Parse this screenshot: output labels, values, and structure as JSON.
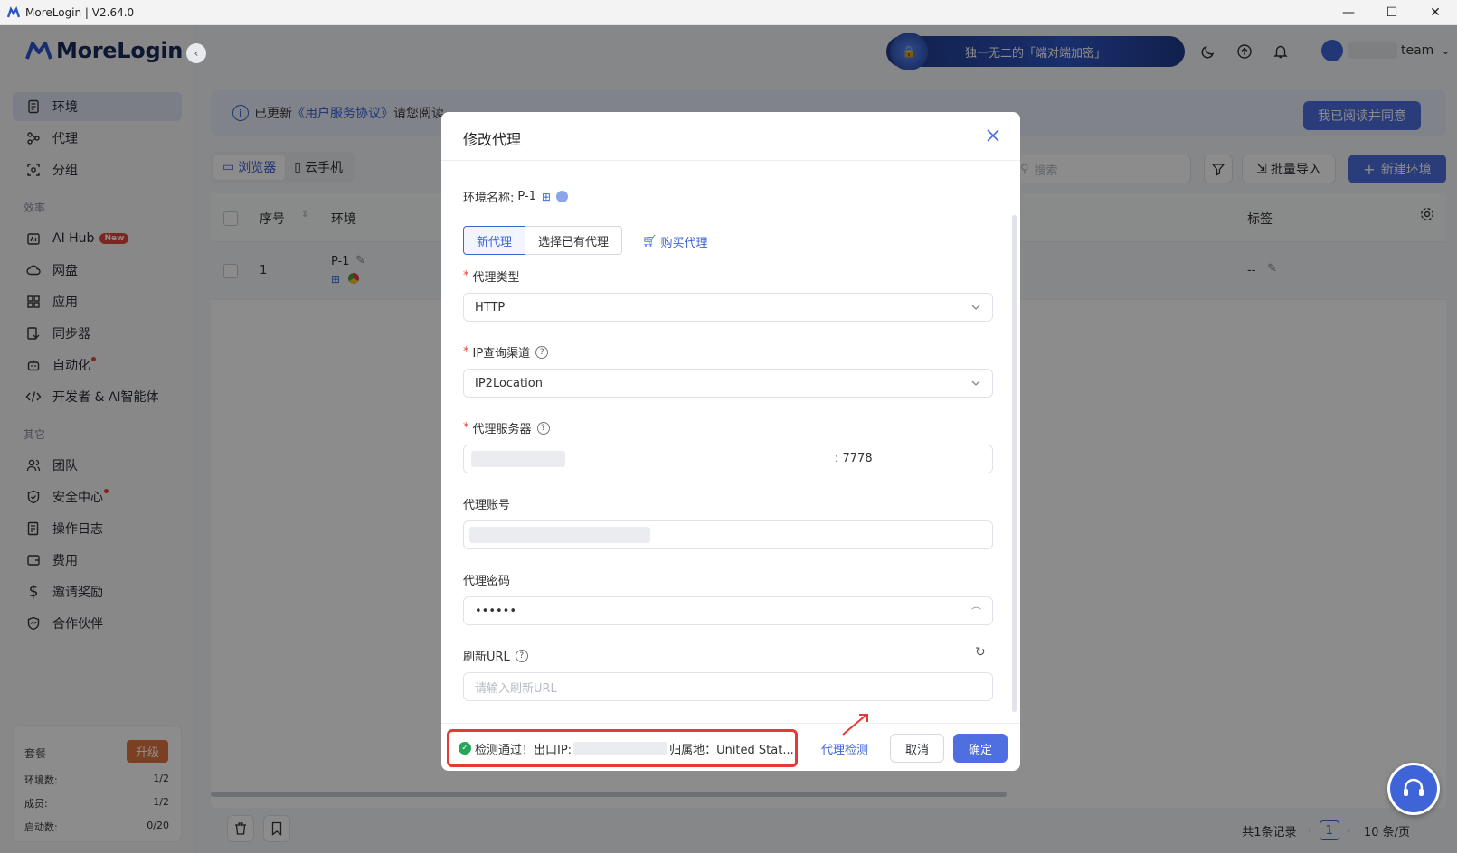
{
  "window": {
    "title": "MoreLogin | V2.64.0"
  },
  "sidebar": {
    "logo": "MoreLogin",
    "items_top": [
      {
        "label": "环境",
        "icon": "doc-icon"
      },
      {
        "label": "代理",
        "icon": "proxy-icon"
      },
      {
        "label": "分组",
        "icon": "group-icon"
      }
    ],
    "section_efficiency": "效率",
    "items_eff": [
      {
        "label": "AI Hub",
        "icon": "ai-icon",
        "badge": "New"
      },
      {
        "label": "网盘",
        "icon": "cloud-icon"
      },
      {
        "label": "应用",
        "icon": "apps-icon"
      },
      {
        "label": "同步器",
        "icon": "sync-icon"
      },
      {
        "label": "自动化",
        "icon": "robot-icon"
      },
      {
        "label": "开发者 & AI智能体",
        "icon": "code-icon"
      }
    ],
    "section_other": "其它",
    "items_other": [
      {
        "label": "团队",
        "icon": "team-icon"
      },
      {
        "label": "安全中心",
        "icon": "shield-icon"
      },
      {
        "label": "操作日志",
        "icon": "log-icon"
      },
      {
        "label": "费用",
        "icon": "wallet-icon"
      },
      {
        "label": "邀请奖励",
        "icon": "dollar-icon"
      },
      {
        "label": "合作伙伴",
        "icon": "partner-icon"
      }
    ],
    "plan": {
      "title": "套餐",
      "upgrade": "升级",
      "rows": [
        {
          "label": "环境数:",
          "value": "1/2"
        },
        {
          "label": "成员:",
          "value": "1/2"
        },
        {
          "label": "启动数:",
          "value": "0/20"
        }
      ]
    }
  },
  "header": {
    "banner": "独一无二的「端对端加密」",
    "user_name": "team"
  },
  "notice": {
    "prefix": "已更新",
    "link": "《用户服务协议》",
    "suffix": "请您阅读",
    "agree_button": "我已阅读并同意"
  },
  "toolbar": {
    "tab_browser": "浏览器",
    "tab_phone": "云手机",
    "search_placeholder": "搜索",
    "import_button": "批量导入",
    "new_button": "新建环境"
  },
  "table": {
    "headers": {
      "index": "序号",
      "env": "环境",
      "tags": "标签"
    },
    "rows": [
      {
        "index": "1",
        "name": "P-1",
        "tag": "--"
      }
    ]
  },
  "pager": {
    "total": "共1条记录",
    "page": "1",
    "page_size": "10 条/页"
  },
  "modal": {
    "title": "修改代理",
    "env_label": "环境名称:",
    "env_name": "P-1",
    "seg_new": "新代理",
    "seg_existing": "选择已有代理",
    "buy_link": "购买代理",
    "proxy_type_label": "代理类型",
    "proxy_type_value": "HTTP",
    "ip_channel_label": "IP查询渠道",
    "ip_channel_value": "IP2Location",
    "server_label": "代理服务器",
    "server_port": ": 7778",
    "account_label": "代理账号",
    "password_label": "代理密码",
    "password_value": "••••••",
    "refresh_label": "刷新URL",
    "refresh_placeholder": "请输入刷新URL",
    "result_prefix": "检测通过！出口IP:",
    "result_location": "归属地：United Stat...",
    "detect_link": "代理检测",
    "cancel": "取消",
    "ok": "确定"
  },
  "colors": {
    "accent": "#4f6edf",
    "highlight": "#e53935",
    "success": "#26a65b"
  }
}
